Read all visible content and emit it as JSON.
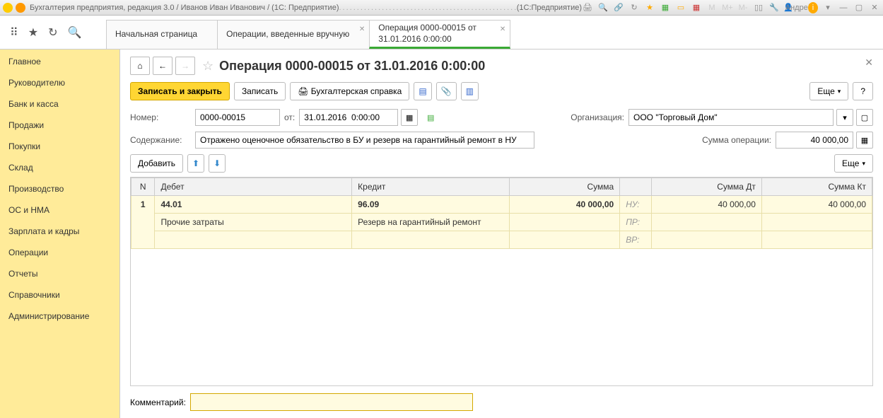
{
  "titlebar": {
    "app_title": "Бухгалтерия предприятия, редакция 3.0 / Иванов Иван Иванович / (1С: Предприятие)",
    "mode": "(1С:Предприятие)",
    "user": "Андрей"
  },
  "tabs": [
    {
      "label": "Начальная страница",
      "closable": false,
      "active": false
    },
    {
      "label": "Операции, введенные вручную",
      "closable": true,
      "active": false
    },
    {
      "label": "Операция 0000-00015 от 31.01.2016 0:00:00",
      "closable": true,
      "active": true
    }
  ],
  "sidebar": {
    "items": [
      "Главное",
      "Руководителю",
      "Банк и касса",
      "Продажи",
      "Покупки",
      "Склад",
      "Производство",
      "ОС и НМА",
      "Зарплата и кадры",
      "Операции",
      "Отчеты",
      "Справочники",
      "Администрирование"
    ]
  },
  "doc": {
    "title": "Операция 0000-00015 от 31.01.2016 0:00:00",
    "buttons": {
      "save_close": "Записать и закрыть",
      "save": "Записать",
      "print": "Бухгалтерская справка",
      "more": "Еще",
      "help": "?",
      "add": "Добавить"
    },
    "labels": {
      "number": "Номер:",
      "from": "от:",
      "org": "Организация:",
      "content": "Содержание:",
      "sum_op": "Сумма операции:",
      "comment": "Комментарий:"
    },
    "fields": {
      "number": "0000-00015",
      "date": "31.01.2016  0:00:00",
      "org": "ООО \"Торговый Дом\"",
      "content": "Отражено оценочное обязательство в БУ и резерв на гарантийный ремонт в НУ",
      "sum_op": "40 000,00",
      "comment": ""
    },
    "table": {
      "headers": {
        "n": "N",
        "debit": "Дебет",
        "credit": "Кредит",
        "sum": "Сумма",
        "sum_dt": "Сумма Дт",
        "sum_kt": "Сумма Кт"
      },
      "rows": [
        {
          "n": "1",
          "debit_acc": "44.01",
          "debit_sub": "Прочие затраты",
          "credit_acc": "96.09",
          "credit_sub": "Резерв на гарантийный ремонт",
          "sum": "40 000,00",
          "tax_labels": [
            "НУ:",
            "ПР:",
            "ВР:"
          ],
          "sum_dt": "40 000,00",
          "sum_kt": "40 000,00"
        }
      ]
    }
  }
}
